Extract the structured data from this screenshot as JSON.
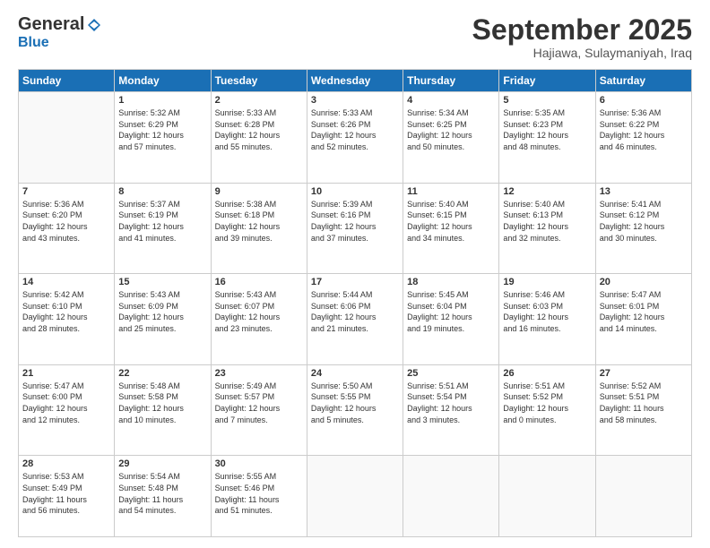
{
  "header": {
    "logo": {
      "general": "General",
      "blue": "Blue"
    },
    "title": "September 2025",
    "location": "Hajiawa, Sulaymaniyah, Iraq"
  },
  "weekdays": [
    "Sunday",
    "Monday",
    "Tuesday",
    "Wednesday",
    "Thursday",
    "Friday",
    "Saturday"
  ],
  "weeks": [
    [
      {
        "day": "",
        "info": ""
      },
      {
        "day": "1",
        "info": "Sunrise: 5:32 AM\nSunset: 6:29 PM\nDaylight: 12 hours\nand 57 minutes."
      },
      {
        "day": "2",
        "info": "Sunrise: 5:33 AM\nSunset: 6:28 PM\nDaylight: 12 hours\nand 55 minutes."
      },
      {
        "day": "3",
        "info": "Sunrise: 5:33 AM\nSunset: 6:26 PM\nDaylight: 12 hours\nand 52 minutes."
      },
      {
        "day": "4",
        "info": "Sunrise: 5:34 AM\nSunset: 6:25 PM\nDaylight: 12 hours\nand 50 minutes."
      },
      {
        "day": "5",
        "info": "Sunrise: 5:35 AM\nSunset: 6:23 PM\nDaylight: 12 hours\nand 48 minutes."
      },
      {
        "day": "6",
        "info": "Sunrise: 5:36 AM\nSunset: 6:22 PM\nDaylight: 12 hours\nand 46 minutes."
      }
    ],
    [
      {
        "day": "7",
        "info": "Sunrise: 5:36 AM\nSunset: 6:20 PM\nDaylight: 12 hours\nand 43 minutes."
      },
      {
        "day": "8",
        "info": "Sunrise: 5:37 AM\nSunset: 6:19 PM\nDaylight: 12 hours\nand 41 minutes."
      },
      {
        "day": "9",
        "info": "Sunrise: 5:38 AM\nSunset: 6:18 PM\nDaylight: 12 hours\nand 39 minutes."
      },
      {
        "day": "10",
        "info": "Sunrise: 5:39 AM\nSunset: 6:16 PM\nDaylight: 12 hours\nand 37 minutes."
      },
      {
        "day": "11",
        "info": "Sunrise: 5:40 AM\nSunset: 6:15 PM\nDaylight: 12 hours\nand 34 minutes."
      },
      {
        "day": "12",
        "info": "Sunrise: 5:40 AM\nSunset: 6:13 PM\nDaylight: 12 hours\nand 32 minutes."
      },
      {
        "day": "13",
        "info": "Sunrise: 5:41 AM\nSunset: 6:12 PM\nDaylight: 12 hours\nand 30 minutes."
      }
    ],
    [
      {
        "day": "14",
        "info": "Sunrise: 5:42 AM\nSunset: 6:10 PM\nDaylight: 12 hours\nand 28 minutes."
      },
      {
        "day": "15",
        "info": "Sunrise: 5:43 AM\nSunset: 6:09 PM\nDaylight: 12 hours\nand 25 minutes."
      },
      {
        "day": "16",
        "info": "Sunrise: 5:43 AM\nSunset: 6:07 PM\nDaylight: 12 hours\nand 23 minutes."
      },
      {
        "day": "17",
        "info": "Sunrise: 5:44 AM\nSunset: 6:06 PM\nDaylight: 12 hours\nand 21 minutes."
      },
      {
        "day": "18",
        "info": "Sunrise: 5:45 AM\nSunset: 6:04 PM\nDaylight: 12 hours\nand 19 minutes."
      },
      {
        "day": "19",
        "info": "Sunrise: 5:46 AM\nSunset: 6:03 PM\nDaylight: 12 hours\nand 16 minutes."
      },
      {
        "day": "20",
        "info": "Sunrise: 5:47 AM\nSunset: 6:01 PM\nDaylight: 12 hours\nand 14 minutes."
      }
    ],
    [
      {
        "day": "21",
        "info": "Sunrise: 5:47 AM\nSunset: 6:00 PM\nDaylight: 12 hours\nand 12 minutes."
      },
      {
        "day": "22",
        "info": "Sunrise: 5:48 AM\nSunset: 5:58 PM\nDaylight: 12 hours\nand 10 minutes."
      },
      {
        "day": "23",
        "info": "Sunrise: 5:49 AM\nSunset: 5:57 PM\nDaylight: 12 hours\nand 7 minutes."
      },
      {
        "day": "24",
        "info": "Sunrise: 5:50 AM\nSunset: 5:55 PM\nDaylight: 12 hours\nand 5 minutes."
      },
      {
        "day": "25",
        "info": "Sunrise: 5:51 AM\nSunset: 5:54 PM\nDaylight: 12 hours\nand 3 minutes."
      },
      {
        "day": "26",
        "info": "Sunrise: 5:51 AM\nSunset: 5:52 PM\nDaylight: 12 hours\nand 0 minutes."
      },
      {
        "day": "27",
        "info": "Sunrise: 5:52 AM\nSunset: 5:51 PM\nDaylight: 11 hours\nand 58 minutes."
      }
    ],
    [
      {
        "day": "28",
        "info": "Sunrise: 5:53 AM\nSunset: 5:49 PM\nDaylight: 11 hours\nand 56 minutes."
      },
      {
        "day": "29",
        "info": "Sunrise: 5:54 AM\nSunset: 5:48 PM\nDaylight: 11 hours\nand 54 minutes."
      },
      {
        "day": "30",
        "info": "Sunrise: 5:55 AM\nSunset: 5:46 PM\nDaylight: 11 hours\nand 51 minutes."
      },
      {
        "day": "",
        "info": ""
      },
      {
        "day": "",
        "info": ""
      },
      {
        "day": "",
        "info": ""
      },
      {
        "day": "",
        "info": ""
      }
    ]
  ]
}
